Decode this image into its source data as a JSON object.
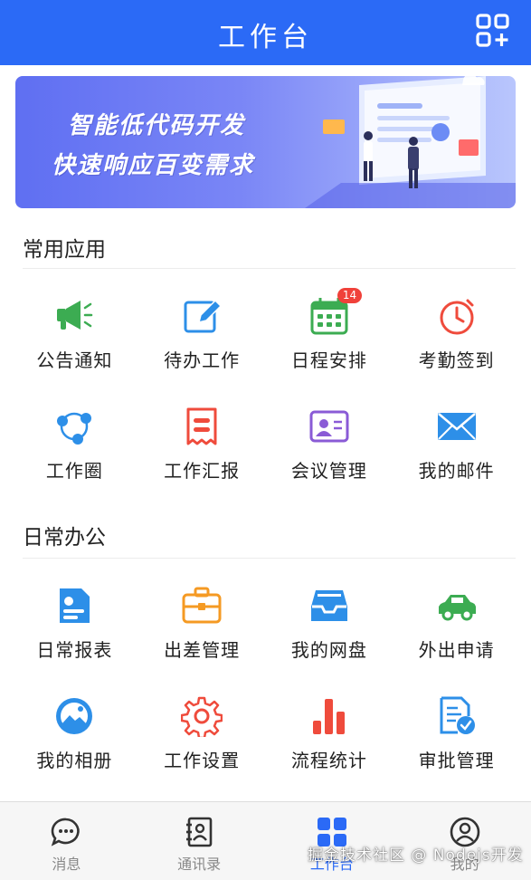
{
  "header": {
    "title": "工作台",
    "add_icon": "grid-add-icon"
  },
  "banner": {
    "line1": "智能低代码开发",
    "line2": "快速响应百变需求"
  },
  "sections": [
    {
      "title": "常用应用",
      "items": [
        {
          "label": "公告通知",
          "icon": "megaphone-icon",
          "color": "#3cac52"
        },
        {
          "label": "待办工作",
          "icon": "edit-icon",
          "color": "#2d8fe8",
          "badge": ""
        },
        {
          "label": "日程安排",
          "icon": "calendar-icon",
          "color": "#3cac52",
          "badge": "14"
        },
        {
          "label": "考勤签到",
          "icon": "clock-icon",
          "color": "#ef4b3c"
        },
        {
          "label": "工作圈",
          "icon": "network-icon",
          "color": "#2d8fe8"
        },
        {
          "label": "工作汇报",
          "icon": "report-icon",
          "color": "#ef4b3c"
        },
        {
          "label": "会议管理",
          "icon": "meeting-card-icon",
          "color": "#8a5bd6"
        },
        {
          "label": "我的邮件",
          "icon": "mail-icon",
          "color": "#2d8fe8"
        }
      ]
    },
    {
      "title": "日常办公",
      "items": [
        {
          "label": "日常报表",
          "icon": "id-card-icon",
          "color": "#2d8fe8"
        },
        {
          "label": "出差管理",
          "icon": "briefcase-icon",
          "color": "#f59a23"
        },
        {
          "label": "我的网盘",
          "icon": "inbox-tray-icon",
          "color": "#2d8fe8"
        },
        {
          "label": "外出申请",
          "icon": "car-icon",
          "color": "#3cac52"
        },
        {
          "label": "我的相册",
          "icon": "photo-album-icon",
          "color": "#2d8fe8"
        },
        {
          "label": "工作设置",
          "icon": "gear-icon",
          "color": "#ef4b3c"
        },
        {
          "label": "流程统计",
          "icon": "bar-chart-icon",
          "color": "#ef4b3c"
        },
        {
          "label": "审批管理",
          "icon": "approval-doc-icon",
          "color": "#2d8fe8"
        }
      ]
    }
  ],
  "tabbar": {
    "tabs": [
      {
        "label": "消息",
        "icon": "chat-bubble-icon"
      },
      {
        "label": "通讯录",
        "icon": "contacts-icon"
      },
      {
        "label": "工作台",
        "icon": "workbench-icon",
        "active": true
      },
      {
        "label": "我的",
        "icon": "user-icon"
      }
    ]
  },
  "watermark": "掘金技术社区 @ Nodejs开发",
  "colors": {
    "primary": "#2b6af6",
    "badge": "#f0413a"
  }
}
